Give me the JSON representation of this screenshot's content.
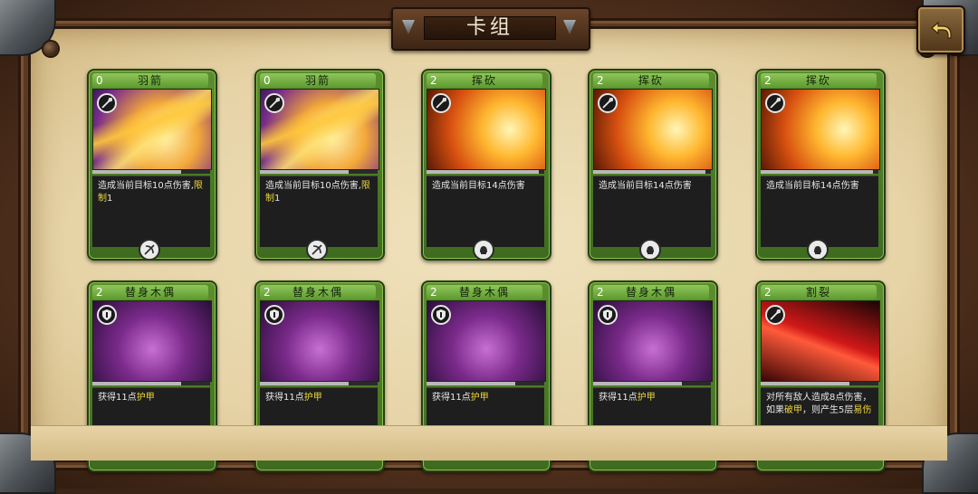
{
  "title": "卡组",
  "icons": {
    "back": "back-arrow-icon",
    "attack_type": "sword-icon",
    "defense_type": "shield-icon",
    "class_archer": "bow-icon",
    "class_warrior": "helmet-icon"
  },
  "colors": {
    "card_green": "#5c8e2e",
    "highlight_yellow": "#f0d83a",
    "parchment": "#e6d3a6"
  },
  "cards": [
    {
      "cost": "0",
      "name": "羽箭",
      "desc": "造成当前目标10点伤害,",
      "desc_hl": "限制",
      "desc_tail": "1",
      "progress": 0.75
    },
    {
      "cost": "0",
      "name": "羽箭",
      "desc": "造成当前目标10点伤害,",
      "desc_hl": "限制",
      "desc_tail": "1",
      "progress": 0.75
    },
    {
      "cost": "2",
      "name": "挥砍",
      "desc": "造成当前目标14点伤害",
      "desc_hl": "",
      "desc_tail": "",
      "progress": 0.95
    },
    {
      "cost": "2",
      "name": "挥砍",
      "desc": "造成当前目标14点伤害",
      "desc_hl": "",
      "desc_tail": "",
      "progress": 0.95
    },
    {
      "cost": "2",
      "name": "挥砍",
      "desc": "造成当前目标14点伤害",
      "desc_hl": "",
      "desc_tail": "",
      "progress": 0.95
    },
    {
      "cost": "2",
      "name": "替身木偶",
      "desc": "获得11点",
      "desc_hl": "护甲",
      "desc_tail": "",
      "progress": 0.75
    },
    {
      "cost": "2",
      "name": "替身木偶",
      "desc": "获得11点",
      "desc_hl": "护甲",
      "desc_tail": "",
      "progress": 0.75
    },
    {
      "cost": "2",
      "name": "替身木偶",
      "desc": "获得11点",
      "desc_hl": "护甲",
      "desc_tail": "",
      "progress": 0.75
    },
    {
      "cost": "2",
      "name": "替身木偶",
      "desc": "获得11点",
      "desc_hl": "护甲",
      "desc_tail": "",
      "progress": 0.75
    },
    {
      "cost": "2",
      "name": "割裂",
      "desc": "对所有敌人造成8点伤害，如果",
      "desc_hl": "破甲",
      "desc_tail": "，则产生5层",
      "desc_hl2": "易伤",
      "progress": 0.75
    }
  ]
}
